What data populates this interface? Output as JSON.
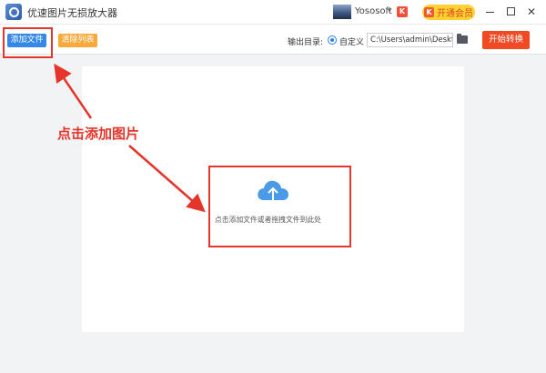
{
  "window": {
    "title": "优速图片无损放大器",
    "username": "Yososoft",
    "badge": "K",
    "vip_label": "开通会员",
    "vip_icon": "K",
    "min_icon": "minimize-icon",
    "max_icon": "maximize-icon",
    "close_glyph": "✕"
  },
  "toolbar": {
    "add_label": "添加文件",
    "clear_label": "清除列表",
    "output_label": "输出目录:",
    "radio_label": "自定义",
    "path_value": "C:\\Users\\admin\\Deskto",
    "start_label": "开始转换"
  },
  "dropzone": {
    "hint": "点击添加文件或者拖拽文件到此处",
    "icon": "cloud-upload-icon"
  },
  "annotation": {
    "text": "点击添加图片",
    "color": "#e5352b"
  },
  "colors": {
    "primary_blue": "#3588e8",
    "clear_orange": "#f7a93a",
    "start_red": "#ef4a24",
    "vip_yellow": "#ffd233",
    "cloud_blue": "#4a9ae8"
  }
}
